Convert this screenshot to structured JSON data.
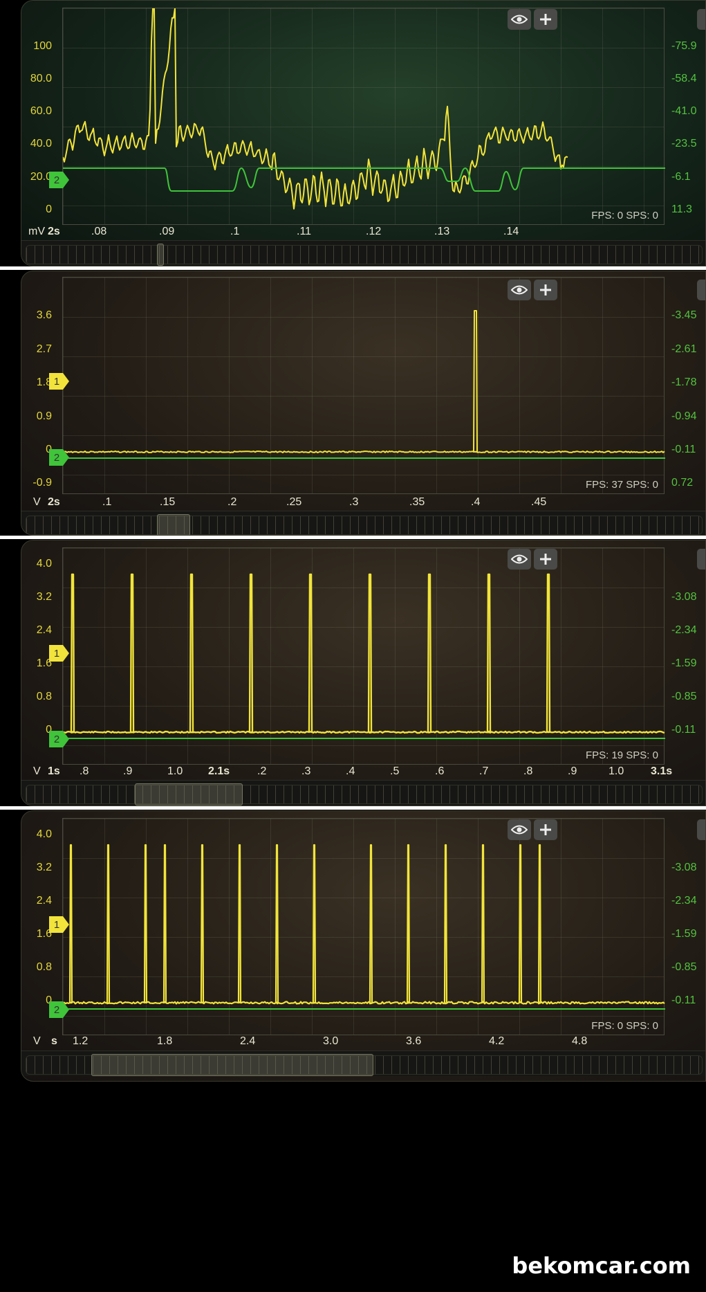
{
  "colors": {
    "ch1": "#f2e43a",
    "ch2": "#3fc43a",
    "bg_green": "#14241a",
    "bg_brown": "#231d16"
  },
  "icons": {
    "visibility": "eye-icon",
    "add": "plus-icon",
    "channel_marker": "tag-marker"
  },
  "watermark": "bekomcar.com",
  "panels": [
    {
      "unit": "mV",
      "timebase": "2s",
      "fps": "FPS: 0  SPS: 0",
      "y_left": [
        "100",
        "80.0",
        "60.0",
        "40.0",
        "20.0",
        "0"
      ],
      "y_right": [
        "-75.9",
        "-58.4",
        "-41.0",
        "-23.5",
        "-6.1",
        "11.3"
      ],
      "x_ticks": [
        ".08",
        ".09",
        ".1",
        ".11",
        ".12",
        ".13",
        ".14"
      ],
      "markers": [
        {
          "label": "2",
          "color": "#3fc43a"
        }
      ]
    },
    {
      "unit": "V",
      "timebase": "2s",
      "fps": "FPS: 37  SPS: 0",
      "y_left": [
        "3.6",
        "2.7",
        "1.8",
        "0.9",
        "0",
        "-0.9"
      ],
      "y_right": [
        "-3.45",
        "-2.61",
        "-1.78",
        "-0.94",
        "-0.11",
        "0.72"
      ],
      "x_ticks": [
        ".1",
        ".15",
        ".2",
        ".25",
        ".3",
        ".35",
        ".4",
        ".45"
      ],
      "markers": [
        {
          "label": "1",
          "color": "#f2e43a"
        },
        {
          "label": "2",
          "color": "#3fc43a"
        }
      ]
    },
    {
      "unit": "V",
      "timebase": "1s",
      "fps": "FPS: 19  SPS: 0",
      "y_left": [
        "4.0",
        "3.2",
        "2.4",
        "1.6",
        "0.8",
        "0"
      ],
      "y_right": [
        "-3.08",
        "-2.34",
        "-1.59",
        "-0.85",
        "-0.11"
      ],
      "x_ticks": [
        ".8",
        ".9",
        "1.0",
        "2.1s",
        ".2",
        ".3",
        ".4",
        ".5",
        ".6",
        ".7",
        ".8",
        ".9",
        "1.0",
        "3.1s"
      ],
      "markers": [
        {
          "label": "1",
          "color": "#f2e43a"
        },
        {
          "label": "2",
          "color": "#3fc43a"
        }
      ]
    },
    {
      "unit": "V",
      "timebase": "s",
      "fps": "FPS: 0  SPS: 0",
      "y_left": [
        "4.0",
        "3.2",
        "2.4",
        "1.6",
        "0.8",
        "0"
      ],
      "y_right": [
        "-3.08",
        "-2.34",
        "-1.59",
        "-0.85",
        "-0.11"
      ],
      "x_ticks": [
        "1.2",
        "1.8",
        "2.4",
        "3.0",
        "3.6",
        "4.2",
        "4.8"
      ],
      "markers": [
        {
          "label": "1",
          "color": "#f2e43a"
        },
        {
          "label": "2",
          "color": "#3fc43a"
        }
      ]
    }
  ]
}
